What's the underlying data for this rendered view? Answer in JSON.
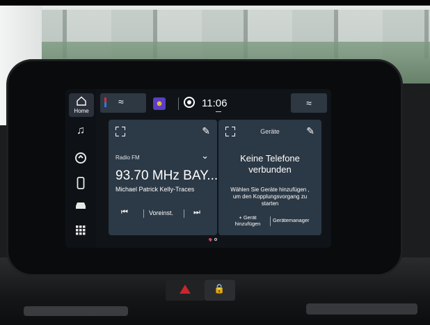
{
  "sidebar": {
    "home_label": "Home",
    "icons": [
      "music-icon",
      "connected-apps-icon",
      "phone-icon",
      "car-icon",
      "apps-grid-icon"
    ]
  },
  "status_bar": {
    "clock": "11:06",
    "icons": [
      "seat-heat-left-icon",
      "app-icon",
      "navigation-icon",
      "seat-heat-right-icon"
    ]
  },
  "radio_card": {
    "source": "Radio FM",
    "frequency": "93.70 MHz BAY...",
    "track": "Michael Patrick Kelly-Traces",
    "presets_label": "Voreinst."
  },
  "phone_card": {
    "header": "Geräte",
    "title_line1": "Keine Telefone",
    "title_line2": "verbunden",
    "hint_line1": "Wählen Sie Geräte hinzufügen ,",
    "hint_line2": "um den Kopplungsvorgang zu",
    "hint_line3": "starten",
    "add_device_line1": "+ Gerät",
    "add_device_line2": "hinzufügen",
    "device_manager": "Gerätemanager"
  },
  "colors": {
    "card": "#2c3946",
    "screen": "#101418",
    "accent_dot": "#e03a5a",
    "app_icon": "#5a3fc2"
  }
}
